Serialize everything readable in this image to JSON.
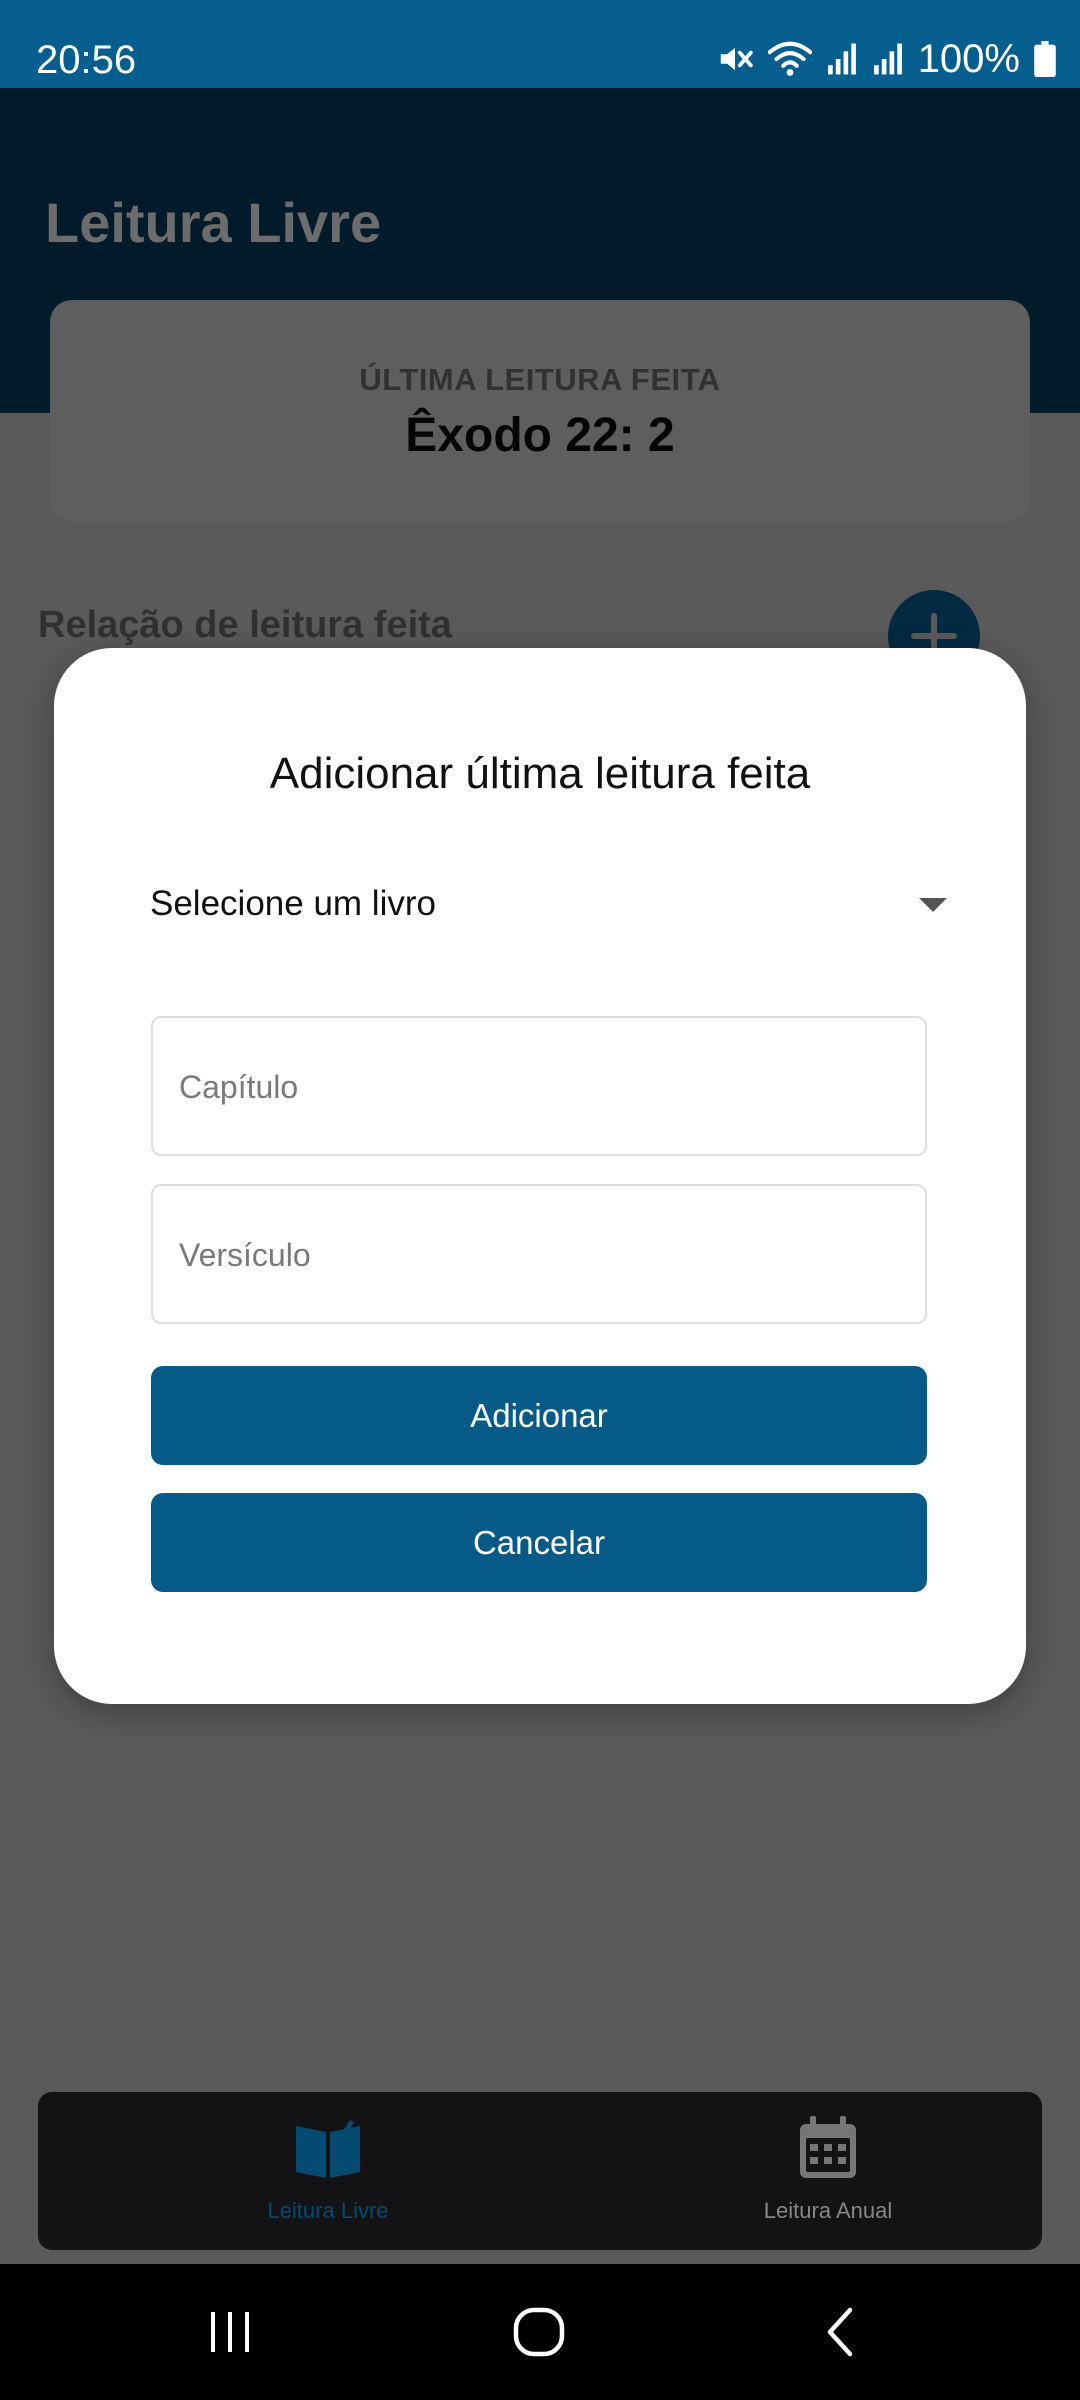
{
  "status_bar": {
    "time": "20:56",
    "battery": "100%",
    "icons": [
      "mute-icon",
      "wifi-icon",
      "signal-icon",
      "signal-icon",
      "battery-icon"
    ]
  },
  "app": {
    "title": "Leitura Livre",
    "last_reading": {
      "label": "ÚLTIMA LEITURA FEITA",
      "value": "Êxodo 22: 2"
    },
    "list_heading": "Relação de leitura feita",
    "add_button_icon": "plus-icon"
  },
  "dialog": {
    "title": "Adicionar última leitura feita",
    "book_select": {
      "value": "Selecione um livro",
      "icon": "caret-down-icon"
    },
    "chapter_field": {
      "placeholder": "Capítulo",
      "value": ""
    },
    "verse_field": {
      "placeholder": "Versículo",
      "value": ""
    },
    "add_button": "Adicionar",
    "cancel_button": "Cancelar"
  },
  "bottom_nav": {
    "items": [
      {
        "label": "Leitura Livre",
        "icon": "open-book-icon",
        "active": true
      },
      {
        "label": "Leitura Anual",
        "icon": "calendar-icon",
        "active": false
      }
    ]
  },
  "system_nav": [
    "recent-apps-icon",
    "home-icon",
    "back-icon"
  ],
  "colors": {
    "primary": "#065a87",
    "status_bar": "#065e8e",
    "overlay_background": "#5a5a5a",
    "dialog_background": "#ffffff"
  }
}
